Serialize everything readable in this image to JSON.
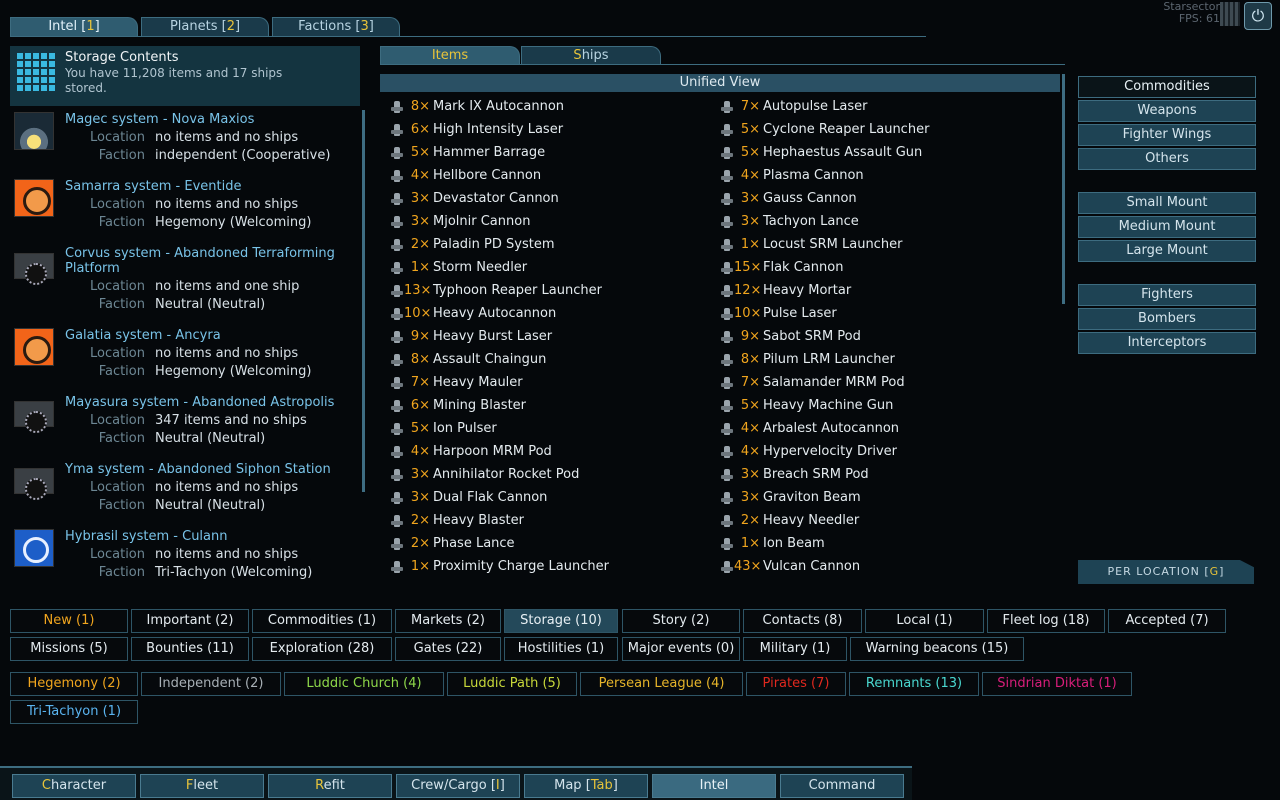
{
  "top_tabs": [
    {
      "label": "Intel [",
      "hotkey": "1",
      "suffix": "]"
    },
    {
      "label": "Planets [",
      "hotkey": "2",
      "suffix": "]"
    },
    {
      "label": "Factions [",
      "hotkey": "3",
      "suffix": "]"
    }
  ],
  "corner": {
    "title": "Starsector",
    "fps": "FPS: 61"
  },
  "storage": {
    "title": "Storage Contents",
    "summary": "You have 11,208 items and 17 ships stored."
  },
  "location_label": "Location",
  "faction_label": "Faction",
  "systems": [
    {
      "name": "Magec system - Nova Maxios",
      "location": "no items and no ships",
      "faction": "independent (Cooperative)"
    },
    {
      "name": "Samarra system - Eventide",
      "location": "no items and no ships",
      "faction": "Hegemony (Welcoming)"
    },
    {
      "name": "Corvus system - Abandoned Terraforming Platform",
      "location": "no items and one ship",
      "faction": "Neutral (Neutral)"
    },
    {
      "name": "Galatia system - Ancyra",
      "location": "no items and no ships",
      "faction": "Hegemony (Welcoming)"
    },
    {
      "name": "Mayasura system - Abandoned Astropolis",
      "location": "347 items and no ships",
      "faction": "Neutral (Neutral)"
    },
    {
      "name": "Yma system - Abandoned Siphon Station",
      "location": "no items and no ships",
      "faction": "Neutral (Neutral)"
    },
    {
      "name": "Hybrasil system - Culann",
      "location": "no items and no ships",
      "faction": "Tri-Tachyon (Welcoming)"
    }
  ],
  "sub_tabs": {
    "items": "Items",
    "ships_hotkey": "S",
    "ships_rest": "hips"
  },
  "unified_view": "Unified View",
  "items_left": [
    {
      "qty": "8×",
      "name": "Mark IX Autocannon"
    },
    {
      "qty": "6×",
      "name": "High Intensity Laser"
    },
    {
      "qty": "5×",
      "name": "Hammer Barrage"
    },
    {
      "qty": "4×",
      "name": "Hellbore Cannon"
    },
    {
      "qty": "3×",
      "name": "Devastator Cannon"
    },
    {
      "qty": "3×",
      "name": "Mjolnir Cannon"
    },
    {
      "qty": "2×",
      "name": "Paladin PD System"
    },
    {
      "qty": "1×",
      "name": "Storm Needler"
    },
    {
      "qty": "13×",
      "name": "Typhoon Reaper Launcher"
    },
    {
      "qty": "10×",
      "name": "Heavy Autocannon"
    },
    {
      "qty": "9×",
      "name": "Heavy Burst Laser"
    },
    {
      "qty": "8×",
      "name": "Assault Chaingun"
    },
    {
      "qty": "7×",
      "name": "Heavy Mauler"
    },
    {
      "qty": "6×",
      "name": "Mining Blaster"
    },
    {
      "qty": "5×",
      "name": "Ion Pulser"
    },
    {
      "qty": "4×",
      "name": "Harpoon MRM Pod"
    },
    {
      "qty": "3×",
      "name": "Annihilator Rocket Pod"
    },
    {
      "qty": "3×",
      "name": "Dual Flak Cannon"
    },
    {
      "qty": "2×",
      "name": "Heavy Blaster"
    },
    {
      "qty": "2×",
      "name": "Phase Lance"
    },
    {
      "qty": "1×",
      "name": "Proximity Charge Launcher"
    }
  ],
  "items_right": [
    {
      "qty": "7×",
      "name": "Autopulse Laser"
    },
    {
      "qty": "5×",
      "name": "Cyclone Reaper Launcher"
    },
    {
      "qty": "5×",
      "name": "Hephaestus Assault Gun"
    },
    {
      "qty": "4×",
      "name": "Plasma Cannon"
    },
    {
      "qty": "3×",
      "name": "Gauss Cannon"
    },
    {
      "qty": "3×",
      "name": "Tachyon Lance"
    },
    {
      "qty": "1×",
      "name": "Locust SRM Launcher"
    },
    {
      "qty": "15×",
      "name": "Flak Cannon"
    },
    {
      "qty": "12×",
      "name": "Heavy Mortar"
    },
    {
      "qty": "10×",
      "name": "Pulse Laser"
    },
    {
      "qty": "9×",
      "name": "Sabot SRM Pod"
    },
    {
      "qty": "8×",
      "name": "Pilum LRM Launcher"
    },
    {
      "qty": "7×",
      "name": "Salamander MRM Pod"
    },
    {
      "qty": "5×",
      "name": "Heavy Machine Gun"
    },
    {
      "qty": "4×",
      "name": "Arbalest Autocannon"
    },
    {
      "qty": "4×",
      "name": "Hypervelocity Driver"
    },
    {
      "qty": "3×",
      "name": "Breach SRM Pod"
    },
    {
      "qty": "3×",
      "name": "Graviton Beam"
    },
    {
      "qty": "2×",
      "name": "Heavy Needler"
    },
    {
      "qty": "1×",
      "name": "Ion Beam"
    },
    {
      "qty": "43×",
      "name": "Vulcan Cannon"
    }
  ],
  "filters": [
    "Commodities",
    "Weapons",
    "Fighter Wings",
    "Others",
    "Small Mount",
    "Medium Mount",
    "Large Mount",
    "Fighters",
    "Bombers",
    "Interceptors"
  ],
  "per_location": {
    "label": "PER LOCATION [",
    "hotkey": "G",
    "suffix": "]"
  },
  "tags_row1": [
    "New (1)",
    "Important (2)",
    "Commodities (1)",
    "Markets (2)",
    "Storage (10)",
    "Story (2)",
    "Contacts (8)",
    "Local (1)",
    "Fleet log (18)",
    "Accepted (7)"
  ],
  "tags_row2": [
    "Missions (5)",
    "Bounties (11)",
    "Exploration (28)",
    "Gates (22)",
    "Hostilities (1)",
    "Major events (0)",
    "Military (1)",
    "Warning beacons (15)"
  ],
  "factions": [
    {
      "label": "Hegemony (2)",
      "color": "#f0a51e"
    },
    {
      "label": "Independent (2)",
      "color": "#a8b0b6"
    },
    {
      "label": "Luddic Church (4)",
      "color": "#8ed84a"
    },
    {
      "label": "Luddic Path (5)",
      "color": "#c8d83a"
    },
    {
      "label": "Persean League (4)",
      "color": "#e6b42a"
    },
    {
      "label": "Pirates (7)",
      "color": "#e0281e"
    },
    {
      "label": "Remnants (13)",
      "color": "#4ad8d0"
    },
    {
      "label": "Sindrian Diktat (1)",
      "color": "#d81e7a"
    },
    {
      "label": "Tri-Tachyon (1)",
      "color": "#5ab4f0"
    }
  ],
  "bottom_nav": [
    {
      "hot": "C",
      "rest": "haracter"
    },
    {
      "hot": "F",
      "rest": "leet"
    },
    {
      "hot": "R",
      "rest": "efit"
    },
    {
      "hot": "",
      "rest": "Crew/Cargo [",
      "hot2": "I",
      "rest2": "]"
    },
    {
      "hot": "",
      "rest": "Map [",
      "hot2": "Tab",
      "rest2": "]"
    },
    {
      "hot": "",
      "rest": "Intel"
    },
    {
      "hot": "",
      "rest": "Command"
    }
  ]
}
